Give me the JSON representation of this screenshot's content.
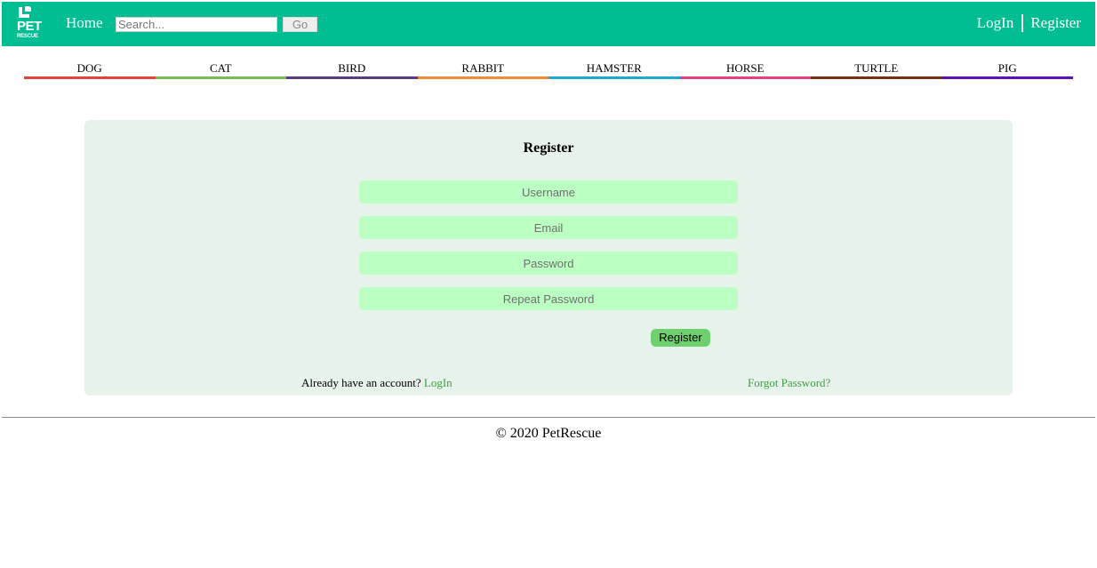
{
  "colors": {
    "header_bg": "#00be91",
    "panel_bg": "#e7f2ea",
    "field_bg": "#bcffc2",
    "button_bg": "#6fd06f",
    "link": "#3f9e45"
  },
  "header": {
    "logo": {
      "line1": "PET",
      "line2": "RESCUE",
      "icon": "dog-logo-icon"
    },
    "home_label": "Home",
    "search": {
      "placeholder": "Search...",
      "value": "",
      "button_label": "Go"
    },
    "login_label": "LogIn",
    "register_label": "Register"
  },
  "categories": [
    {
      "label": "DOG",
      "color": "#e0443a"
    },
    {
      "label": "CAT",
      "color": "#7cbc58"
    },
    {
      "label": "BIRD",
      "color": "#5b3a85"
    },
    {
      "label": "RABBIT",
      "color": "#ef8a36"
    },
    {
      "label": "HAMSTER",
      "color": "#1ea9d5"
    },
    {
      "label": "HORSE",
      "color": "#e0437e"
    },
    {
      "label": "TURTLE",
      "color": "#7a2f12"
    },
    {
      "label": "PIG",
      "color": "#5a12b8"
    }
  ],
  "form": {
    "title": "Register",
    "username_placeholder": "Username",
    "email_placeholder": "Email",
    "password_placeholder": "Password",
    "repeat_password_placeholder": "Repeat Password",
    "submit_label": "Register",
    "already_text": "Already have an account?",
    "login_link": "LogIn",
    "forgot_link": "Forgot Password?"
  },
  "footer": {
    "text": "© 2020 PetRescue"
  }
}
